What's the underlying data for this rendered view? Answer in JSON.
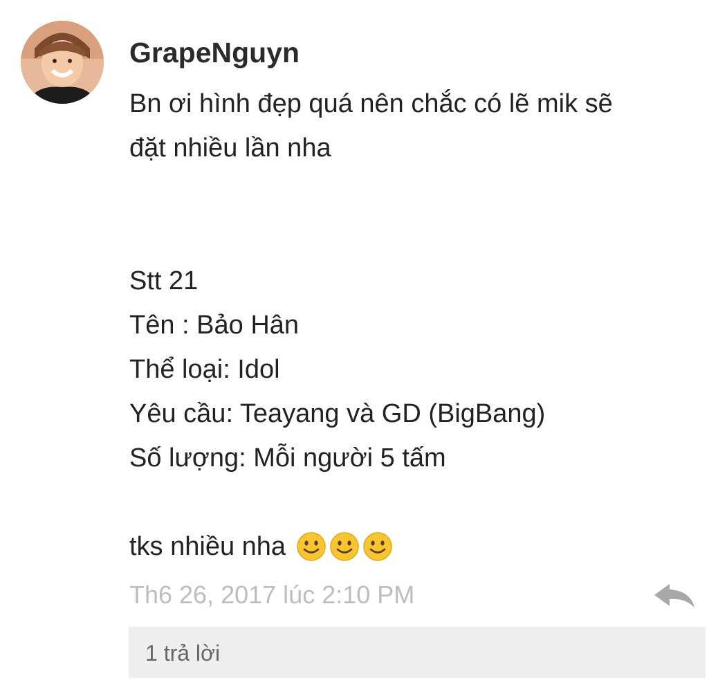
{
  "comment": {
    "author": "GrapeNguyn",
    "avatar_icon": "user-avatar-photo",
    "body_lines": [
      "Bn ơi hình đẹp quá nên chắc có lẽ mik sẽ",
      "đặt nhiều lần nha",
      "",
      "",
      "Stt 21",
      "Tên : Bảo Hân",
      "Thể loại: Idol",
      "Yêu cầu: Teayang và GD (BigBang)",
      "Số lượng: Mỗi người 5 tấm",
      "",
      "tks nhiều nha"
    ],
    "emoji": [
      "slightly-smiling-face",
      "slightly-smiling-face",
      "slightly-smiling-face"
    ],
    "timestamp": "Th6 26, 2017 lúc 2:10 PM",
    "reply_icon": "reply-arrow-icon",
    "replies_label": "1 trả lời"
  },
  "colors": {
    "author": "#2b2b2b",
    "body": "#222222",
    "timestamp": "#bdbdbd",
    "reply_icon": "#a8a8a8",
    "replies_bg": "#eeeeee",
    "replies_text": "#666666",
    "emoji_fill": "#f7c531"
  }
}
